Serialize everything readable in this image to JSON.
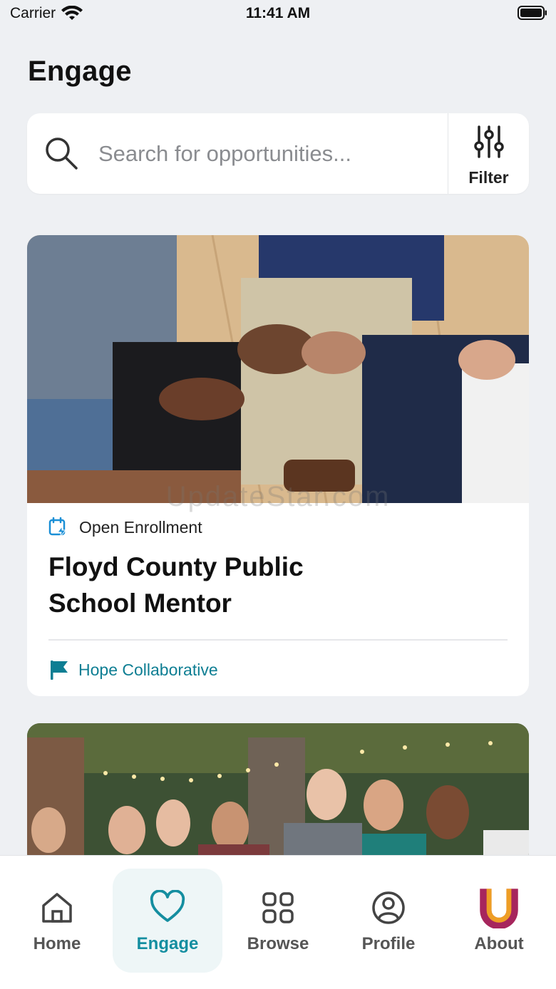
{
  "status_bar": {
    "carrier": "Carrier",
    "time": "11:41 AM"
  },
  "header": {
    "title": "Engage"
  },
  "search": {
    "placeholder": "Search for opportunities...",
    "filter_label": "Filter"
  },
  "opportunities": [
    {
      "status": "Open Enrollment",
      "title": "Floyd County Public School Mentor",
      "organization": "Hope Collaborative",
      "watermark": "UpdateStar.com"
    }
  ],
  "tabbar": {
    "items": [
      {
        "label": "Home",
        "icon": "home-icon",
        "active": false
      },
      {
        "label": "Engage",
        "icon": "heart-icon",
        "active": true
      },
      {
        "label": "Browse",
        "icon": "grid-icon",
        "active": false
      },
      {
        "label": "Profile",
        "icon": "user-circle-icon",
        "active": false
      },
      {
        "label": "About",
        "icon": "u-logo-icon",
        "active": false
      }
    ]
  },
  "colors": {
    "accent": "#148ea0",
    "org_link": "#0e7e93",
    "background": "#eef0f3"
  }
}
